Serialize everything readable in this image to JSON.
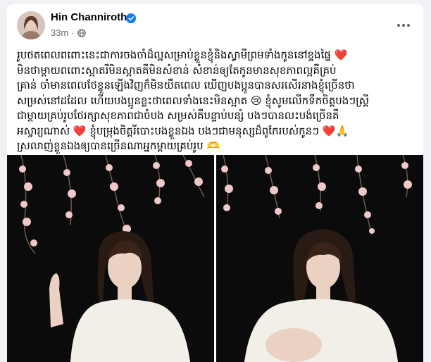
{
  "post": {
    "author_name": "Hin Channiroth",
    "timestamp": "33m",
    "separator": "·",
    "text_lines": [
      "រូបថតពេលពពោះនេះជាការចងចាំដ៏ល្អសម្រាប់ខ្លួនខ្ញុំនិងស្វាមីព្រមទាំងកូននៅខ្ទងផ្ទៃ ❤️",
      "មិនថាម្ដាយពពោះស្អាតរឺមិនស្អាតគឺមិនសំខាន់ សំខាន់ឲ្យតែកូនមានសុខភាពល្អគឺគ្រប់",
      "គ្រាន់ ចាំមានពេលថែខ្លួនឡើងវិញក៏មិនយឺតពេល ឃើញបងប្អូនបានសរសើរនាងខ្ញុំច្រើនថា",
      "សម្រស់នៅដដែល ហើយបងប្អូនខ្លះថាពេលទាំងនេះមិនស្អាត 😢 ខ្ញុំសូមលើកទឹកចិត្តបងៗស្រ្តី",
      "ជាម្ដាយគ្រប់រូបថែរក្សាសុខភាពជាចំបង សម្រស់គឺបន្ទាប់បន្សំ បងៗបានលះបង់ច្រើនគឺ",
      "អស្ចារ្យណាស់ ❤️ ខ្ញុំបម្រុងចិត្តរីបោះបងខ្លួនឯង បងៗជាមនុស្សដ៏ពូកែរបស់កូនៗ ❤️🙏",
      "ស្រលាញ់ខ្លួនឯងឲ្យបានច្រើនណាអ្នកម្ដាយគ្រប់រូប 🫶"
    ]
  },
  "icons": {
    "verified": "verified-badge-icon",
    "privacy": "globe-icon",
    "more": "more-options-icon"
  },
  "colors": {
    "name": "#050505",
    "meta": "#65676b",
    "verified": "#1877f2",
    "photo_background": "#0b0b0b",
    "dress": "#f2efe9",
    "blossom": "#efc9c7"
  }
}
